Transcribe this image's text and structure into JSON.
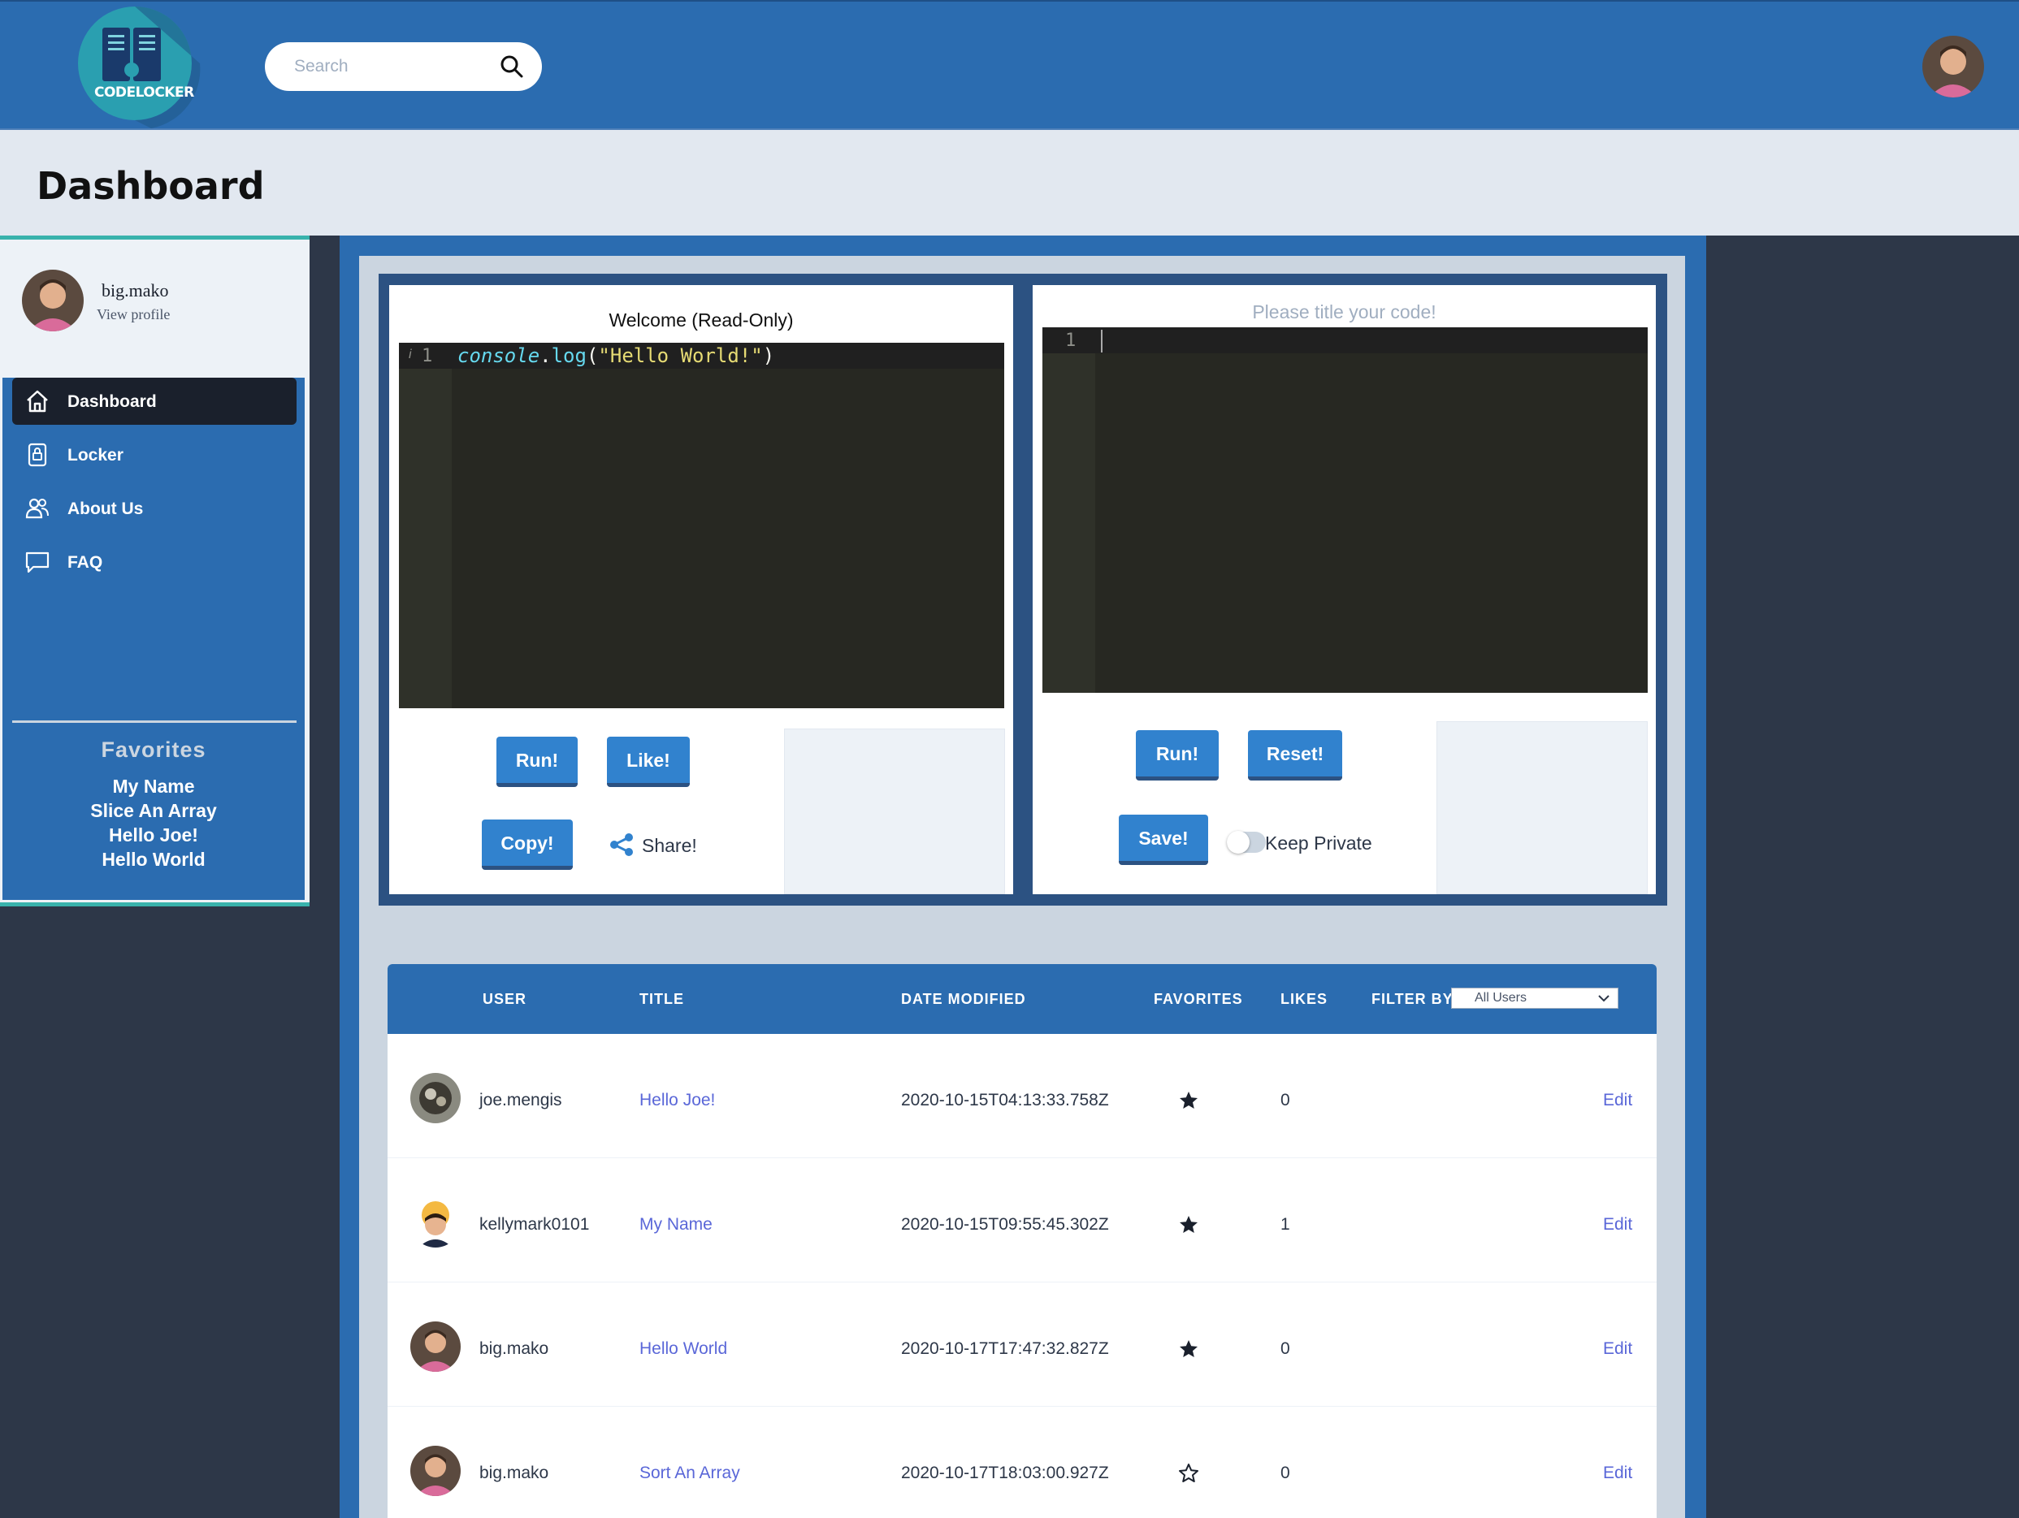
{
  "header": {
    "logo_text": "CODELOCKER",
    "search_placeholder": "Search"
  },
  "page": {
    "title": "Dashboard"
  },
  "sidebar": {
    "profile": {
      "name": "big.mako",
      "link": "View profile"
    },
    "nav": [
      {
        "label": "Dashboard",
        "icon": "home-icon",
        "active": true
      },
      {
        "label": "Locker",
        "icon": "lock-icon",
        "active": false
      },
      {
        "label": "About Us",
        "icon": "users-icon",
        "active": false
      },
      {
        "label": "FAQ",
        "icon": "chat-icon",
        "active": false
      }
    ],
    "favorites_title": "Favorites",
    "favorites": [
      "My Name",
      "Slice An Array",
      "Hello Joe!",
      "Hello World"
    ]
  },
  "editor_left": {
    "title": "Welcome (Read-Only)",
    "line_number": "1",
    "code": {
      "obj": "console",
      "dot": ".",
      "fn": "log",
      "open": "(",
      "str": "\"Hello World!\"",
      "close": ")"
    },
    "buttons": {
      "run": "Run!",
      "like": "Like!",
      "copy": "Copy!"
    },
    "share_label": "Share!"
  },
  "editor_right": {
    "title_placeholder": "Please title your code!",
    "line_number": "1",
    "buttons": {
      "run": "Run!",
      "reset": "Reset!",
      "save": "Save!"
    },
    "private_label": "Keep Private",
    "private_on": false
  },
  "table": {
    "headers": {
      "user": "USER",
      "title": "TITLE",
      "date": "DATE MODIFIED",
      "favorites": "FAVORITES",
      "likes": "LIKES",
      "filter": "FILTER BY"
    },
    "filter_value": "All Users",
    "rows": [
      {
        "user": "joe.mengis",
        "title": "Hello Joe!",
        "date": "2020-10-15T04:13:33.758Z",
        "favorited": true,
        "likes": "0",
        "action": "Edit"
      },
      {
        "user": "kellymark0101",
        "title": "My Name",
        "date": "2020-10-15T09:55:45.302Z",
        "favorited": true,
        "likes": "1",
        "action": "Edit"
      },
      {
        "user": "big.mako",
        "title": "Hello World",
        "date": "2020-10-17T17:47:32.827Z",
        "favorited": true,
        "likes": "0",
        "action": "Edit"
      },
      {
        "user": "big.mako",
        "title": "Sort An Array",
        "date": "2020-10-17T18:03:00.927Z",
        "favorited": false,
        "likes": "0",
        "action": "Edit"
      }
    ]
  },
  "colors": {
    "primary": "#2b6cb0",
    "dark": "#2d3748",
    "accent_teal": "#38b2ac",
    "button": "#3182ce",
    "link": "#5a67d8",
    "editor_bg": "#272822"
  }
}
